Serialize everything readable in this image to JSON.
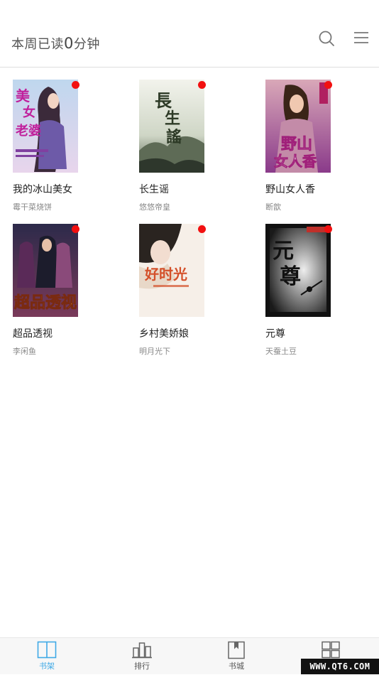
{
  "header": {
    "reading_prefix": "本周已读",
    "reading_minutes": "0",
    "reading_suffix": "分钟"
  },
  "books": [
    {
      "title": "我的冰山美女",
      "author": "霉干菜烧饼",
      "cover_text": "美女老婆",
      "has_update": true
    },
    {
      "title": "长生谣",
      "author": "悠悠帝皇",
      "cover_text": "長生謠",
      "has_update": true
    },
    {
      "title": "野山女人香",
      "author": "断歆",
      "cover_text": "野山女人香",
      "has_update": true
    },
    {
      "title": "超品透视",
      "author": "李闲鱼",
      "cover_text": "超品透视",
      "has_update": true
    },
    {
      "title": "乡村美娇娘",
      "author": "明月光下",
      "cover_text": "好时光",
      "has_update": true
    },
    {
      "title": "元尊",
      "author": "天蚕土豆",
      "cover_text": "元尊",
      "has_update": true
    }
  ],
  "tabs": [
    {
      "label": "书架",
      "active": true
    },
    {
      "label": "排行",
      "active": false
    },
    {
      "label": "书城",
      "active": false
    },
    {
      "label": "",
      "active": false
    }
  ],
  "watermark": "WWW.QT6.COM",
  "colors": {
    "accent": "#3fa9e6",
    "update_dot": "#f21010"
  }
}
